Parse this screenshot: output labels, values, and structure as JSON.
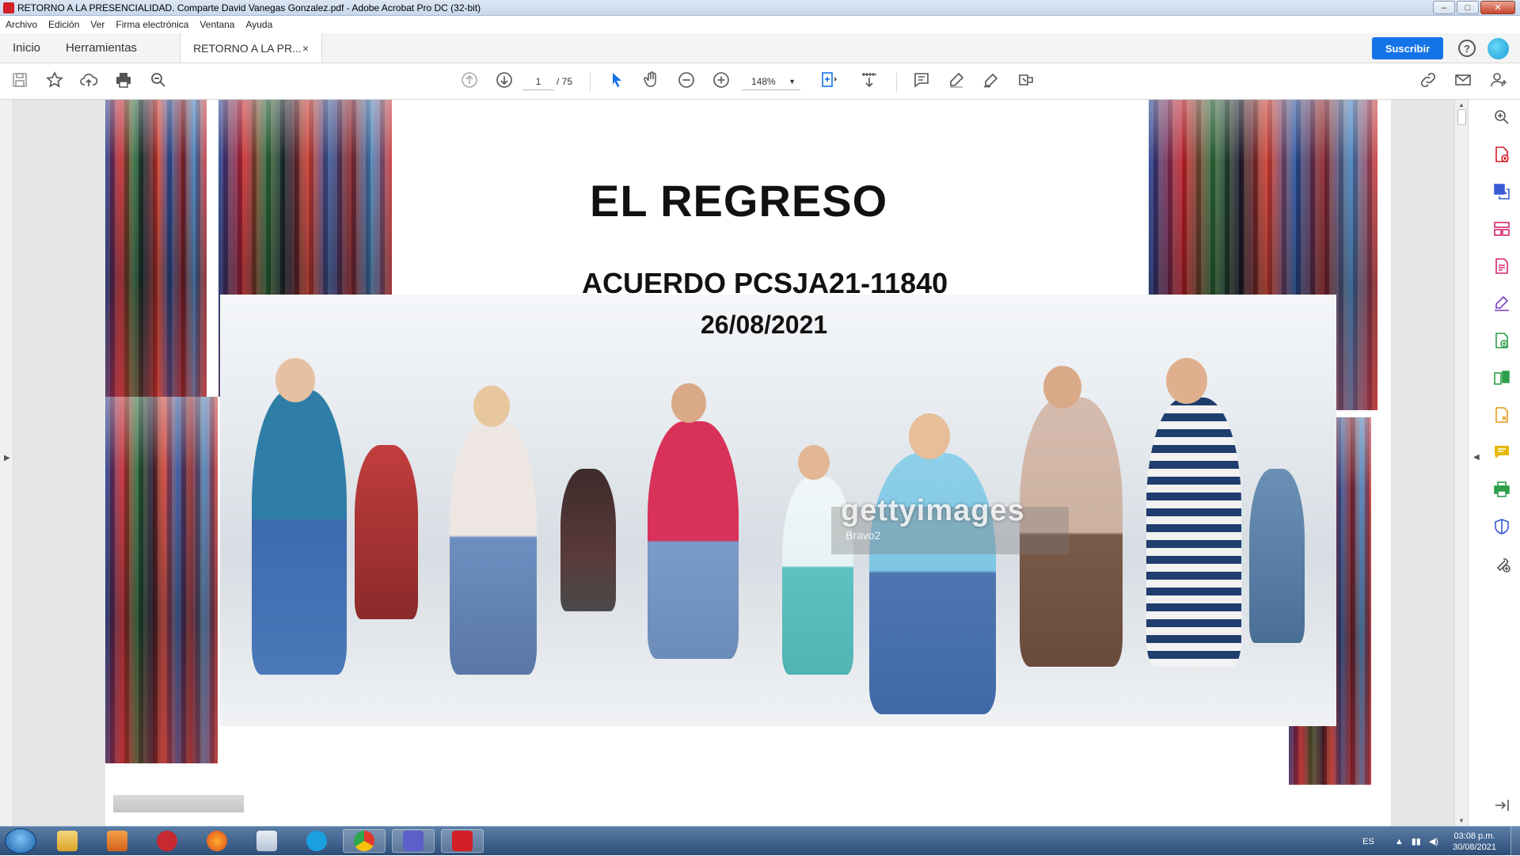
{
  "window": {
    "title": "RETORNO A LA PRESENCIALIDAD. Comparte David Vanegas Gonzalez.pdf - Adobe Acrobat Pro DC (32-bit)"
  },
  "menu": [
    "Archivo",
    "Edición",
    "Ver",
    "Firma electrónica",
    "Ventana",
    "Ayuda"
  ],
  "tabs": {
    "home": "Inicio",
    "tools": "Herramientas",
    "doc": "RETORNO A LA PR...",
    "close": "×"
  },
  "header": {
    "subscribe": "Suscribir",
    "help": "?"
  },
  "toolbar": {
    "page_current": "1",
    "page_total": "/ 75",
    "zoom": "148%"
  },
  "document": {
    "title": "EL REGRESO",
    "subtitle": "ACUERDO PCSJA21-11840",
    "date": "26/08/2021",
    "watermark": "gettyimages",
    "watermark_sub": "Bravo2"
  },
  "taskbar": {
    "lang": "ES",
    "time": "03:08 p.m.",
    "date": "30/08/2021"
  },
  "colors": {
    "accent": "#1473e6",
    "pdf_red": "#d31f26",
    "tool_purple": "#7a3fbf",
    "tool_green": "#2e9e4a",
    "tool_orange": "#e69a1a",
    "tool_pink": "#d6246e"
  }
}
